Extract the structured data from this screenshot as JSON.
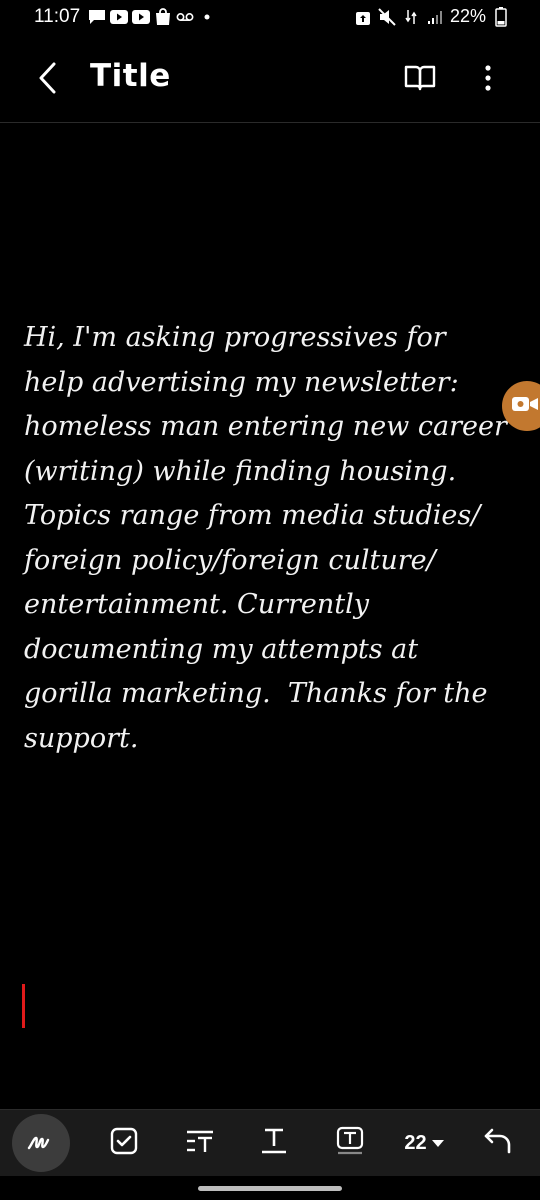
{
  "status_bar": {
    "time": "11:07",
    "battery_percent": "22%",
    "left_icons": [
      "chat-icon",
      "youtube-icon",
      "youtube-icon",
      "shopping-bag-icon",
      "voicemail-icon",
      "dot-icon"
    ],
    "right_icons": [
      "lock-icon",
      "mute-icon",
      "data-icon",
      "signal-icon",
      "battery-icon"
    ]
  },
  "app_bar": {
    "title": "Title",
    "back_icon": "back-arrow-icon",
    "read_mode_icon": "open-book-icon",
    "more_icon": "more-vertical-icon"
  },
  "note": {
    "text": "Hi, I'm asking progressives for\nhelp advertising my newsletter:\nhomeless man entering new career\n(writing) while finding housing.\nTopics range from media studies/\nforeign policy/foreign culture/\nentertainment. Currently\ndocumenting my attempts at\ngorilla marketing.  Thanks for the\nsupport."
  },
  "toolbar": {
    "font_size": "22",
    "tools": [
      "handwriting-icon",
      "checkbox-icon",
      "paragraph-style-icon",
      "text-format-icon",
      "text-box-icon",
      "font-size-dropdown",
      "undo-icon"
    ]
  },
  "colors": {
    "background": "#000000",
    "toolbar": "#1b1b1b",
    "cursor": "#e01a1a",
    "floating_handle": "#c2782f"
  }
}
